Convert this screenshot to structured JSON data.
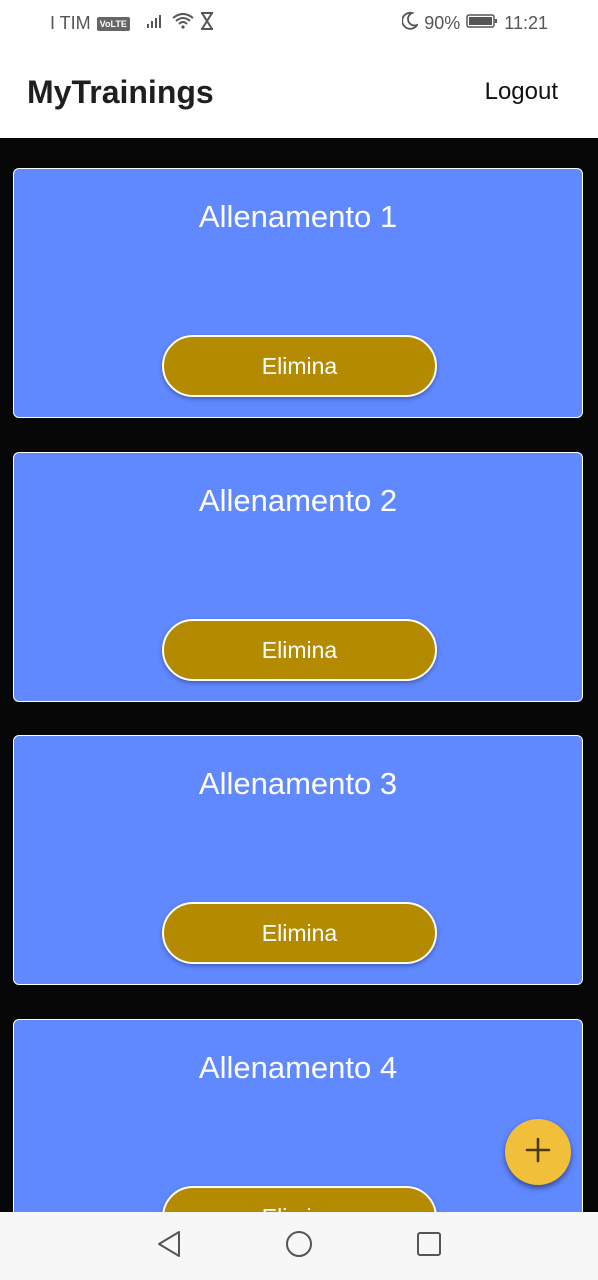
{
  "status_bar": {
    "carrier": "I TIM",
    "volte": "VoLTE",
    "battery": "90%",
    "time": "11:21"
  },
  "app_bar": {
    "title": "MyTrainings",
    "logout_label": "Logout"
  },
  "trainings": [
    {
      "title": "Allenamento 1",
      "delete_label": "Elimina"
    },
    {
      "title": "Allenamento 2",
      "delete_label": "Elimina"
    },
    {
      "title": "Allenamento 3",
      "delete_label": "Elimina"
    },
    {
      "title": "Allenamento 4",
      "delete_label": "Elimina"
    }
  ],
  "fab": {
    "icon": "plus-icon"
  },
  "colors": {
    "card": "#6088ff",
    "delete_button": "#b38a00",
    "fab": "#f2bf3a",
    "background": "#070707"
  }
}
